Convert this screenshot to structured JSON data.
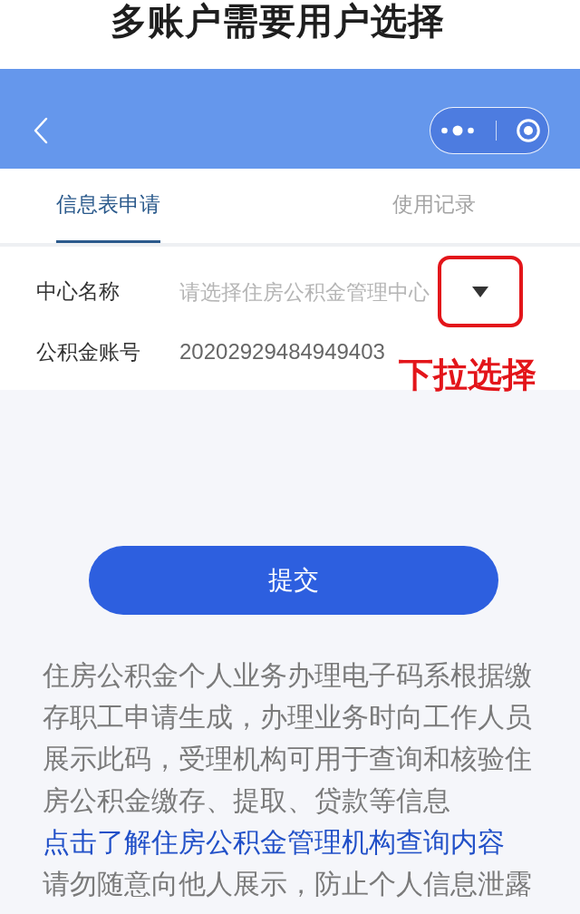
{
  "heading": {
    "text": "多账户需要用户选择"
  },
  "tabs": [
    {
      "label": "信息表申请",
      "selected": true
    },
    {
      "label": "使用记录",
      "selected": false
    }
  ],
  "form": {
    "fields": [
      {
        "kind": "select",
        "label": "中心名称",
        "placeholder": "请选择住房公积金管理中心",
        "highlighted": true
      },
      {
        "kind": "text",
        "label": "公积金账号",
        "value": "20202929484949403"
      }
    ]
  },
  "annotation": {
    "text": "下拉选择"
  },
  "submit_button": {
    "label": "提交"
  },
  "notes": [
    {
      "kind": "text",
      "text": "住房公积金个人业务办理电子码系根据缴存职工申请生成，办理业务时向工作人员展示此码，受理机构可用于查询和核验住房公积金缴存、提取、贷款等信息"
    },
    {
      "kind": "link",
      "text": "点击了解住房公积金管理机构查询内容"
    },
    {
      "kind": "text",
      "text": "请勿随意向他人展示，防止个人信息泄露"
    }
  ]
}
